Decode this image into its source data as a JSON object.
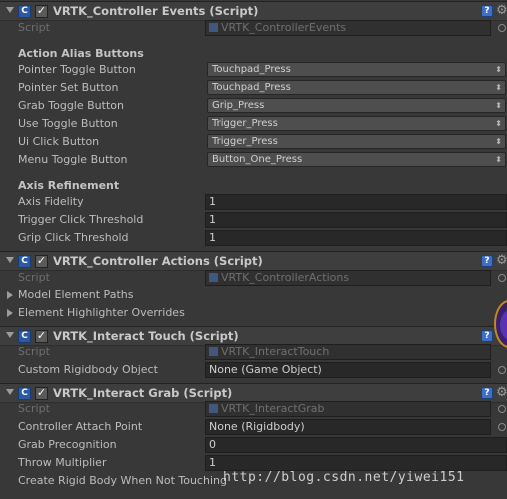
{
  "components": [
    {
      "title": "VRTK_Controller Events (Script)",
      "expanded": true,
      "enabled": true,
      "script_label": "Script",
      "script_value": "VRTK_ControllerEvents",
      "sections": [
        {
          "header": "Action Alias Buttons",
          "fields": [
            {
              "label": "Pointer Toggle Button",
              "value": "Touchpad_Press"
            },
            {
              "label": "Pointer Set Button",
              "value": "Touchpad_Press"
            },
            {
              "label": "Grab Toggle Button",
              "value": "Grip_Press"
            },
            {
              "label": "Use Toggle Button",
              "value": "Trigger_Press"
            },
            {
              "label": "Ui Click Button",
              "value": "Trigger_Press"
            },
            {
              "label": "Menu Toggle Button",
              "value": "Button_One_Press"
            }
          ]
        },
        {
          "header": "Axis Refinement",
          "fields": [
            {
              "label": "Axis Fidelity",
              "value": "1"
            },
            {
              "label": "Trigger Click Threshold",
              "value": "1"
            },
            {
              "label": "Grip Click Threshold",
              "value": "1"
            }
          ]
        }
      ]
    },
    {
      "title": "VRTK_Controller Actions (Script)",
      "expanded": true,
      "enabled": true,
      "script_label": "Script",
      "script_value": "VRTK_ControllerActions",
      "foldouts": [
        "Model Element Paths",
        "Element Highlighter Overrides"
      ]
    },
    {
      "title": "VRTK_Interact Touch (Script)",
      "expanded": true,
      "enabled": true,
      "script_label": "Script",
      "script_value": "VRTK_InteractTouch",
      "fields": [
        {
          "label": "Custom Rigidbody Object",
          "value": "None (Game Object)"
        }
      ]
    },
    {
      "title": "VRTK_Interact Grab (Script)",
      "expanded": true,
      "enabled": true,
      "script_label": "Script",
      "script_value": "VRTK_InteractGrab",
      "fields": [
        {
          "label": "Controller Attach Point",
          "value": "None (Rigidbody)"
        },
        {
          "label": "Grab Precognition",
          "value": "0"
        },
        {
          "label": "Throw Multiplier",
          "value": "1"
        },
        {
          "label": "Create Rigid Body When Not Touching",
          "value": ""
        }
      ]
    }
  ],
  "icons": {
    "component": "csharp-script-icon",
    "enabled": "checkbox-checked-icon",
    "help": "help-book-icon",
    "settings": "gear-icon",
    "picker": "object-picker-icon"
  },
  "watermark": "http://blog.csdn.net/yiwei151",
  "colors": {
    "background": "#383838",
    "header": "#3e3e3e",
    "field": "#282828",
    "text": "#bdbdbd"
  }
}
